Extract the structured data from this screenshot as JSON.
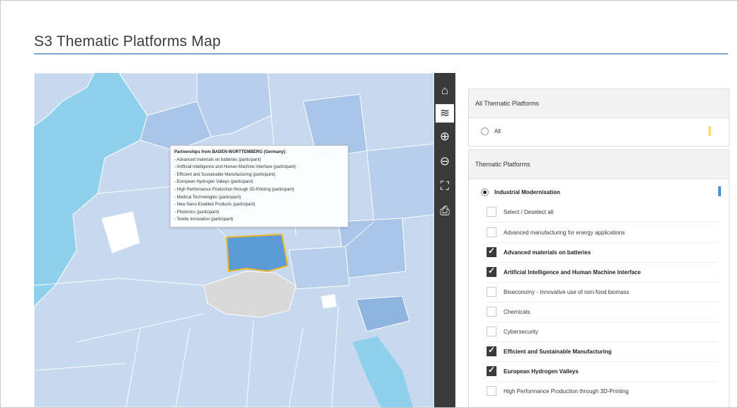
{
  "page_title": "S3 Thematic Platforms Map",
  "colors": {
    "sea": "#8fd0ec",
    "accent_rule": "#7fa8d1",
    "selected_region": "#5b9bd5",
    "selected_border": "#f0b429",
    "switzerland": "#d9d9d9",
    "toolbar_bg": "#3a3a3a",
    "all_swatch": "#f7e08a",
    "industrial_swatch": "#4a90d9"
  },
  "map": {
    "tooltip": {
      "title": "Partnerships from BADEN-WÜRTTEMBERG (Germany):",
      "lines": [
        "- Advanced materials on batteries (participant)",
        "- Artificial Intelligence and Human Machine Interface (participant)",
        "- Efficient and Sustainable Manufacturing (participant)",
        "- European Hydrogen Valleys (participant)",
        "- High Performance Production through 3D-Printing (participant)",
        "- Medical Technologies (participant)",
        "- New Nano-Enabled Products (participant)",
        "- Photonics (participant)",
        "- Textile Innovation (participant)"
      ]
    }
  },
  "toolbar": {
    "tools": [
      {
        "name": "home-icon",
        "glyph": "⌂"
      },
      {
        "name": "layers-icon",
        "glyph": "≋"
      },
      {
        "name": "zoom-in-icon",
        "glyph": "⊕"
      },
      {
        "name": "zoom-out-icon",
        "glyph": "⊖"
      },
      {
        "name": "fullscreen-icon",
        "glyph": "⛶"
      },
      {
        "name": "print-icon",
        "glyph": "⎙"
      }
    ],
    "active_tool": "layers-icon"
  },
  "panels": {
    "all": {
      "header": "All Thematic Platforms",
      "option_label": "All",
      "selected": false
    },
    "thematic": {
      "header": "Thematic Platforms",
      "group_label": "Industrial Modernisation",
      "group_selected": true,
      "items": [
        {
          "label": "Select / Deselect all",
          "checked": false
        },
        {
          "label": "Advanced manufacturing for energy applications",
          "checked": false
        },
        {
          "label": "Advanced materials on batteries",
          "checked": true
        },
        {
          "label": "Artificial Intelligence and Human Machine Interface",
          "checked": true
        },
        {
          "label": "Bioeconomy - Innovative use of non-food biomass",
          "checked": false
        },
        {
          "label": "Chemicals",
          "checked": false
        },
        {
          "label": "Cybersecurity",
          "checked": false
        },
        {
          "label": "Efficient and Sustainable Manufacturing",
          "checked": true
        },
        {
          "label": "European Hydrogen Valleys",
          "checked": true
        },
        {
          "label": "High Performance Production through 3D-Printing",
          "checked": false
        }
      ]
    }
  }
}
